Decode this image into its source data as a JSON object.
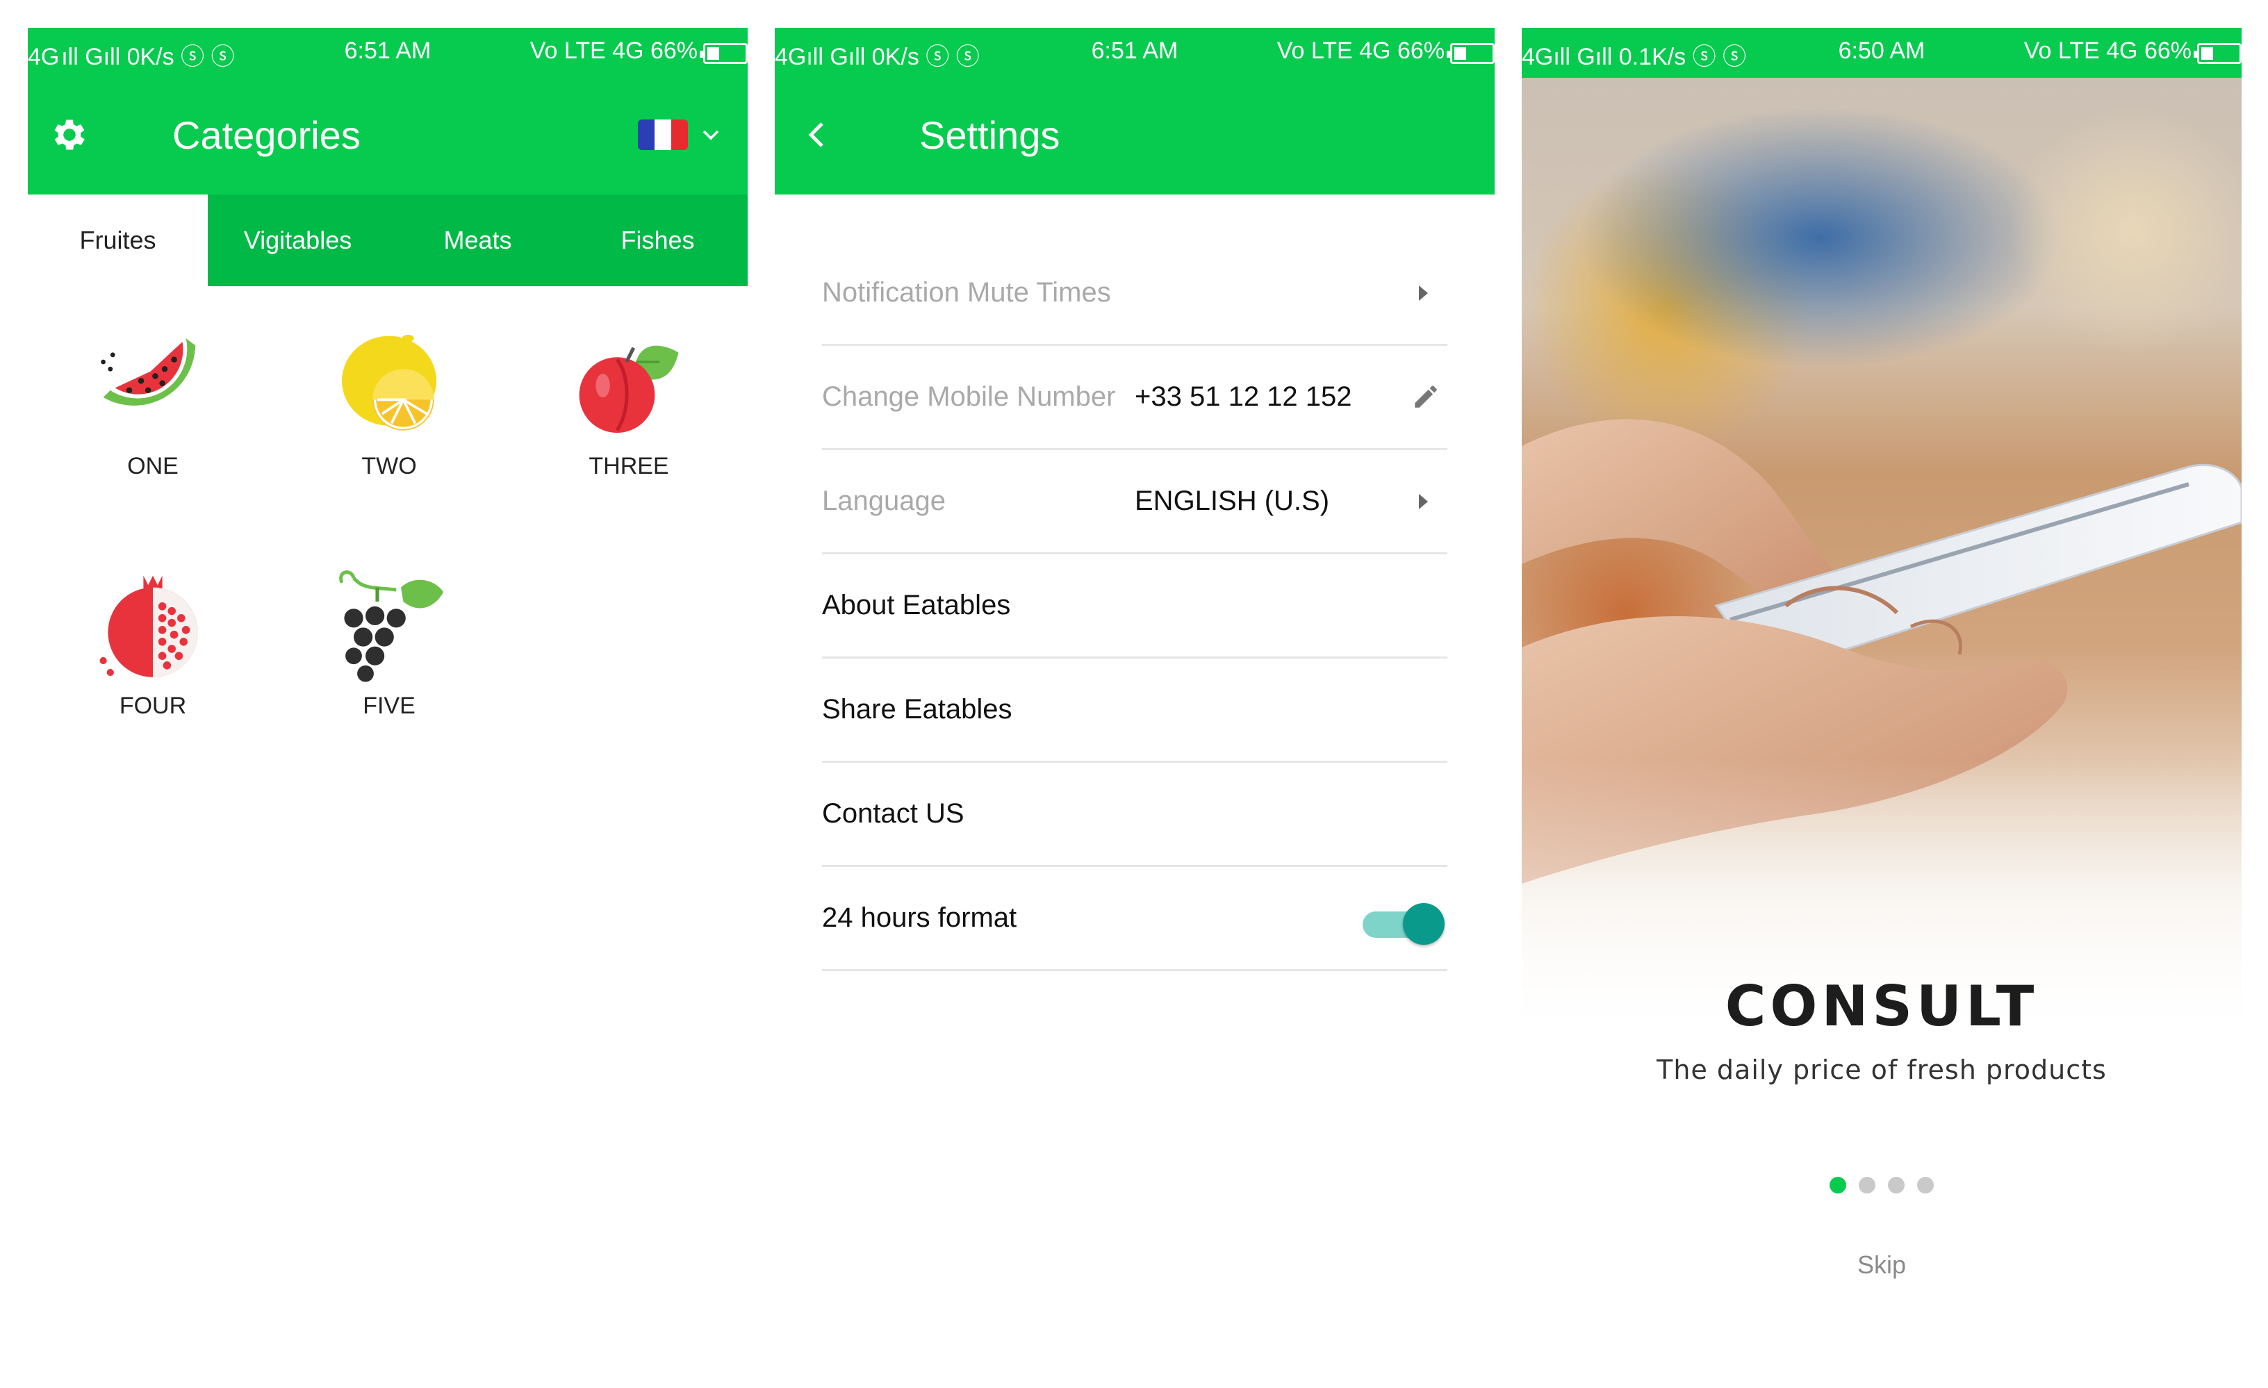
{
  "screens": {
    "categories": {
      "status": {
        "left": "4G ıll Gıll 0K/s ⓢ ⓢ",
        "time": "6:51 AM",
        "right": "Vo LTE 4G 66%"
      },
      "title": "Categories",
      "tabs": [
        {
          "label": "Fruites",
          "active": true
        },
        {
          "label": "Vigitables"
        },
        {
          "label": "Meats"
        },
        {
          "label": "Fishes"
        }
      ],
      "items": [
        {
          "label": "ONE",
          "icon": "watermelon-icon"
        },
        {
          "label": "TWO",
          "icon": "lemon-icon"
        },
        {
          "label": "THREE",
          "icon": "plum-icon"
        },
        {
          "label": "FOUR",
          "icon": "pomegranate-icon"
        },
        {
          "label": "FIVE",
          "icon": "grapes-icon"
        }
      ],
      "language_flag": "france-flag",
      "colors": {
        "primary": "#07cb4e",
        "tab_bar": "#00b947"
      }
    },
    "settings": {
      "status": {
        "left": "4Gıll Gıll 0K/s ⓢ ⓢ",
        "time": "6:51 AM",
        "right": "Vo LTE 4G 66%"
      },
      "title": "Settings",
      "rows": [
        {
          "label": "Notification Mute Times"
        },
        {
          "label": "Change Mobile Number",
          "value": "+33 51 12 12 152"
        },
        {
          "label": "Language",
          "value": "ENGLISH (U.S)"
        },
        {
          "label": "About Eatables"
        },
        {
          "label": "Share Eatables"
        },
        {
          "label": "Contact US"
        },
        {
          "label": "24 hours format",
          "toggle": true
        }
      ],
      "colors": {
        "toggle": "#0a9a8c"
      }
    },
    "onboarding": {
      "status": {
        "left": "4Gıll Gıll 0.1K/s ⓢ ⓢ",
        "time": "6:50 AM",
        "right": "Vo LTE 4G 66%"
      },
      "heading": "CONSULT",
      "tagline": "The daily price of fresh products",
      "page_indicator": {
        "current": 1,
        "total": 4
      },
      "skip_label": "Skip"
    }
  }
}
